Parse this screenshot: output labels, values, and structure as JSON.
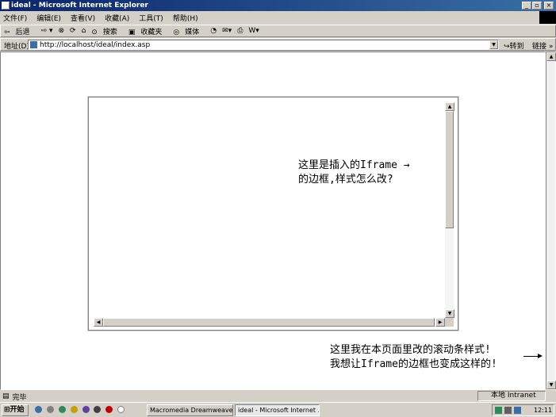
{
  "window": {
    "title": "ideal - Microsoft Internet Explorer"
  },
  "menu": [
    "文件(F)",
    "编辑(E)",
    "查看(V)",
    "收藏(A)",
    "工具(T)",
    "帮助(H)"
  ],
  "toolbar": {
    "back": "后退",
    "search": "搜索",
    "favorites": "收藏夹",
    "media": "媒体"
  },
  "address": {
    "label": "地址(D)",
    "url": "http://localhost/ideal/index.asp",
    "go": "转到",
    "links": "链接"
  },
  "notes": {
    "iframe": [
      "这里是插入的Iframe →",
      "的边框,样式怎么改?"
    ],
    "page": [
      "这里我在本页面里改的滚动条样式!",
      "我想让Iframe的边框也变成这样的!"
    ]
  },
  "status": {
    "text": "完毕",
    "zone": "本地 Intranet"
  },
  "taskbar": {
    "start": "开始",
    "tasks": [
      "Macromedia Dreamweave...",
      "ideal - Microsoft Internet ..."
    ],
    "clock": "12:11"
  },
  "colors": {
    "titlebar": "#0a246a",
    "chrome": "#d4d0c8"
  }
}
